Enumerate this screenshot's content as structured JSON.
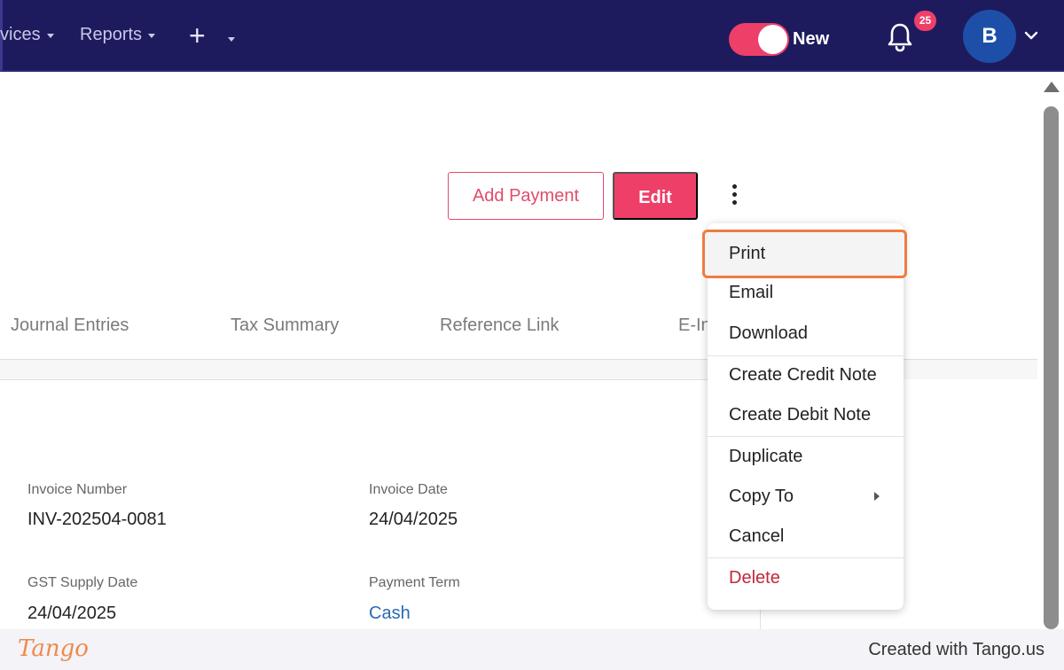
{
  "nav": {
    "items": [
      {
        "label": "vices"
      },
      {
        "label": "Reports"
      }
    ],
    "plus": "+",
    "toggle_label": "New",
    "notification_count": "25",
    "avatar_initial": "B"
  },
  "actions": {
    "add_payment": "Add Payment",
    "edit": "Edit"
  },
  "tabs": [
    {
      "label": "Journal Entries"
    },
    {
      "label": "Tax Summary"
    },
    {
      "label": "Reference Link"
    },
    {
      "label": "E-In"
    }
  ],
  "fields": {
    "invoice_number_label": "Invoice Number",
    "invoice_number_value": "INV-202504-0081",
    "invoice_date_label": "Invoice Date",
    "invoice_date_value": "24/04/2025",
    "gst_supply_date_label": "GST Supply Date",
    "gst_supply_date_value": "24/04/2025",
    "payment_term_label": "Payment Term",
    "payment_term_value": "Cash"
  },
  "menu": {
    "items": [
      {
        "label": "Print"
      },
      {
        "label": "Email"
      },
      {
        "label": "Download"
      },
      {
        "label": "Create Credit Note"
      },
      {
        "label": "Create Debit Note"
      },
      {
        "label": "Duplicate"
      },
      {
        "label": "Copy To"
      },
      {
        "label": "Cancel"
      },
      {
        "label": "Delete"
      }
    ],
    "highlighted": "Print"
  },
  "footer": {
    "logo": "Tango",
    "credit": "Created with Tango.us"
  },
  "colors": {
    "navbar": "#1d1b5e",
    "accent": "#ee3f69",
    "highlight_border": "#f07b40",
    "link": "#2a6ab5",
    "danger": "#c0283a"
  }
}
